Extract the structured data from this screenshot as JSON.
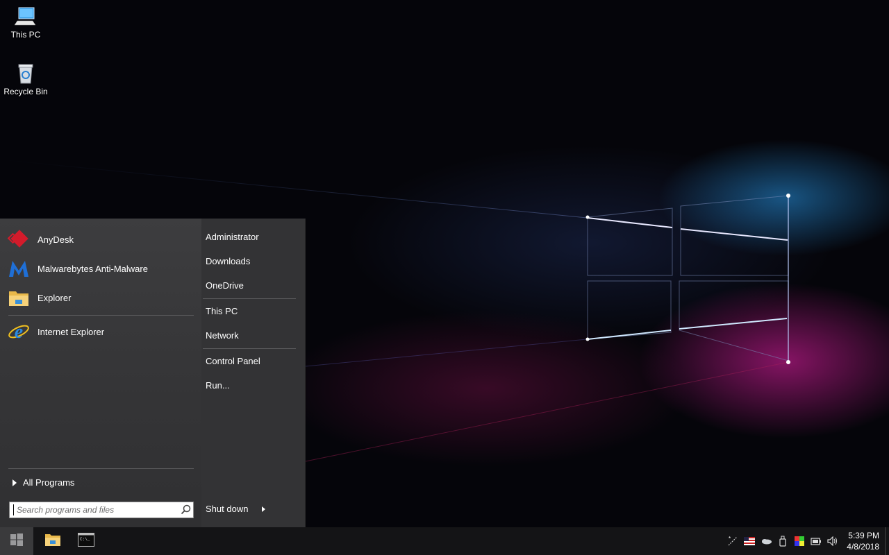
{
  "desktop": {
    "icons": [
      {
        "label": "This PC",
        "icon": "computer-icon"
      },
      {
        "label": "Recycle Bin",
        "icon": "recycle-bin-icon"
      }
    ],
    "wallpaper": "windows-10-logo-light-beams"
  },
  "start_menu": {
    "programs": [
      {
        "label": "AnyDesk",
        "icon": "anydesk-icon"
      },
      {
        "label": "Malwarebytes Anti-Malware",
        "icon": "malwarebytes-icon"
      },
      {
        "label": "Explorer",
        "icon": "folder-icon"
      },
      {
        "label": "Internet Explorer",
        "icon": "internet-explorer-icon"
      }
    ],
    "all_programs_label": "All Programs",
    "search_placeholder": "Search programs and files",
    "places": [
      {
        "label": "Administrator"
      },
      {
        "label": "Downloads"
      },
      {
        "label": "OneDrive"
      },
      {
        "label": "This PC"
      },
      {
        "label": "Network"
      },
      {
        "label": "Control Panel"
      },
      {
        "label": "Run..."
      }
    ],
    "shutdown_label": "Shut down"
  },
  "taskbar": {
    "pinned": [
      {
        "name": "file-explorer",
        "icon": "folder-icon"
      },
      {
        "name": "command-prompt",
        "icon": "terminal-icon"
      }
    ],
    "tray": [
      "network-activity-icon",
      "language-flag-icon",
      "onedrive-icon",
      "usb-device-icon",
      "color-icon",
      "battery-icon",
      "volume-icon"
    ],
    "clock": {
      "time": "5:39 PM",
      "date": "4/8/2018"
    }
  },
  "colors": {
    "start_menu_bg": "#333335",
    "taskbar_bg": "#141416",
    "start_button_active": "#3a3a3c",
    "beam_blue": "#2a96e6",
    "beam_magenta": "#dc1ea0"
  }
}
